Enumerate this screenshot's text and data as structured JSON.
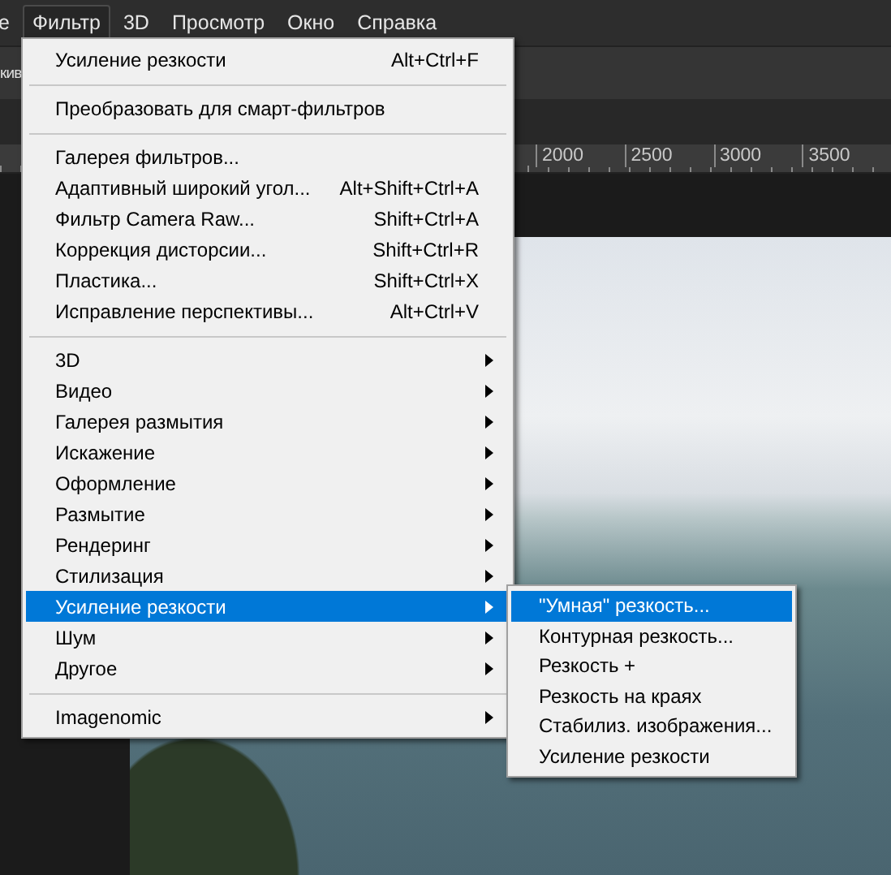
{
  "menubar": {
    "items": [
      {
        "label": "е",
        "selected": false
      },
      {
        "label": "Фильтр",
        "selected": true
      },
      {
        "label": "3D",
        "selected": false
      },
      {
        "label": "Просмотр",
        "selected": false
      },
      {
        "label": "Окно",
        "selected": false
      },
      {
        "label": "Справка",
        "selected": false
      }
    ]
  },
  "options_bar": {
    "text": "кив"
  },
  "ruler": {
    "labels": [
      "2000",
      "2500",
      "3000",
      "3500"
    ]
  },
  "filter_menu": {
    "groups": [
      [
        {
          "label": "Усиление резкости",
          "shortcut": "Alt+Ctrl+F",
          "has_submenu": false,
          "selected": false
        }
      ],
      [
        {
          "label": "Преобразовать для смарт-фильтров",
          "has_submenu": false,
          "selected": false
        }
      ],
      [
        {
          "label": "Галерея фильтров...",
          "has_submenu": false,
          "selected": false
        },
        {
          "label": "Адаптивный широкий угол...",
          "shortcut": "Alt+Shift+Ctrl+A",
          "has_submenu": false,
          "selected": false
        },
        {
          "label": "Фильтр Camera Raw...",
          "shortcut": "Shift+Ctrl+A",
          "has_submenu": false,
          "selected": false
        },
        {
          "label": "Коррекция дисторсии...",
          "shortcut": "Shift+Ctrl+R",
          "has_submenu": false,
          "selected": false
        },
        {
          "label": "Пластика...",
          "shortcut": "Shift+Ctrl+X",
          "has_submenu": false,
          "selected": false
        },
        {
          "label": "Исправление перспективы...",
          "shortcut": "Alt+Ctrl+V",
          "has_submenu": false,
          "selected": false
        }
      ],
      [
        {
          "label": "3D",
          "has_submenu": true,
          "selected": false
        },
        {
          "label": "Видео",
          "has_submenu": true,
          "selected": false
        },
        {
          "label": "Галерея размытия",
          "has_submenu": true,
          "selected": false
        },
        {
          "label": "Искажение",
          "has_submenu": true,
          "selected": false
        },
        {
          "label": "Оформление",
          "has_submenu": true,
          "selected": false
        },
        {
          "label": "Размытие",
          "has_submenu": true,
          "selected": false
        },
        {
          "label": "Рендеринг",
          "has_submenu": true,
          "selected": false
        },
        {
          "label": "Стилизация",
          "has_submenu": true,
          "selected": false
        },
        {
          "label": "Усиление резкости",
          "has_submenu": true,
          "selected": true
        },
        {
          "label": "Шум",
          "has_submenu": true,
          "selected": false
        },
        {
          "label": "Другое",
          "has_submenu": true,
          "selected": false
        }
      ],
      [
        {
          "label": "Imagenomic",
          "has_submenu": true,
          "selected": false
        }
      ]
    ]
  },
  "submenu": {
    "items": [
      {
        "label": "\"Умная\" резкость...",
        "selected": true
      },
      {
        "label": "Контурная резкость...",
        "selected": false
      },
      {
        "label": "Резкость +",
        "selected": false
      },
      {
        "label": "Резкость на краях",
        "selected": false
      },
      {
        "label": "Стабилиз. изображения...",
        "selected": false
      },
      {
        "label": "Усиление резкости",
        "selected": false
      }
    ]
  }
}
